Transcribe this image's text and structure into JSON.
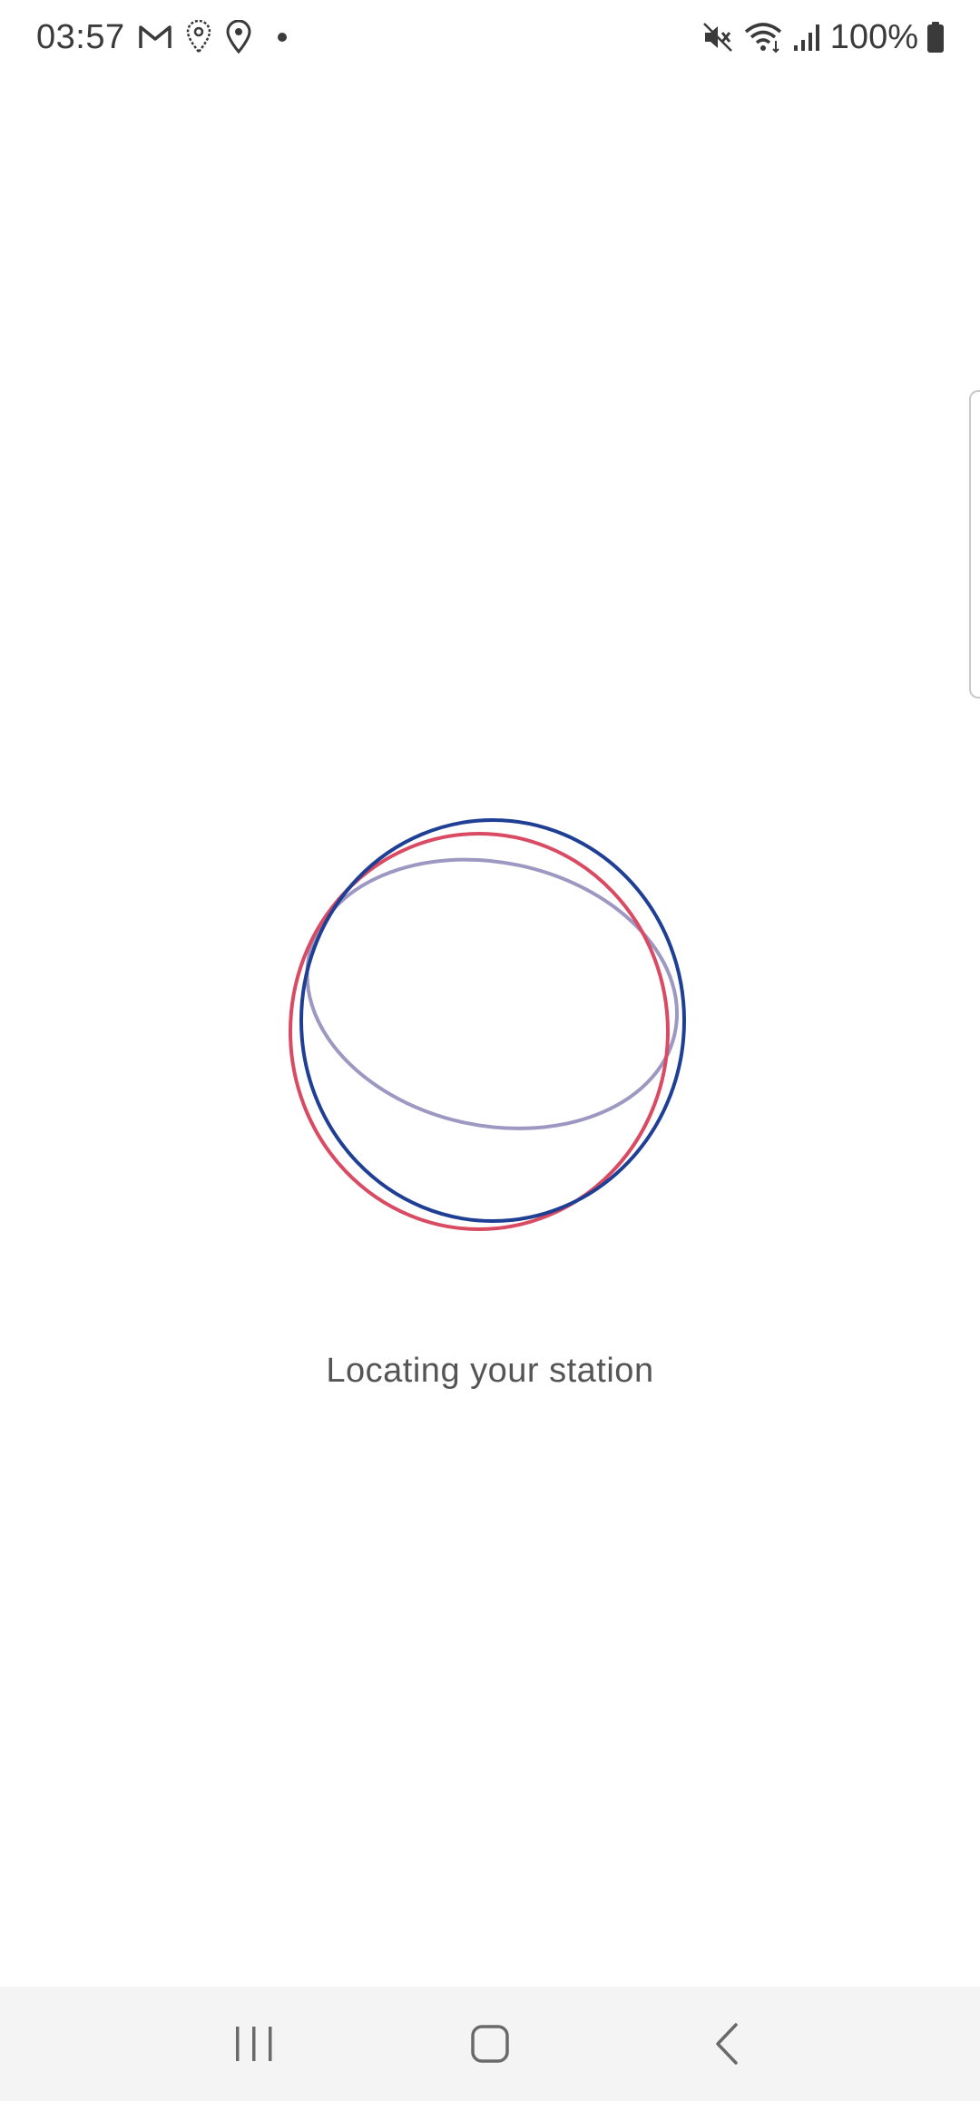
{
  "status_bar": {
    "time": "03:57",
    "left_icons": [
      "gmail-icon",
      "location-outline-icon",
      "location-icon",
      "notification-dot-icon"
    ],
    "right_icons": [
      "mute-icon",
      "wifi-icon",
      "signal-icon",
      "battery-icon"
    ],
    "battery": "100%"
  },
  "main": {
    "loading_text": "Locating your station",
    "loader_colors": {
      "blue": "#1f3f95",
      "red": "#d94a63",
      "lavender": "#9c98c2"
    }
  },
  "nav_bar": {
    "buttons": [
      "recent-apps",
      "home",
      "back"
    ]
  }
}
